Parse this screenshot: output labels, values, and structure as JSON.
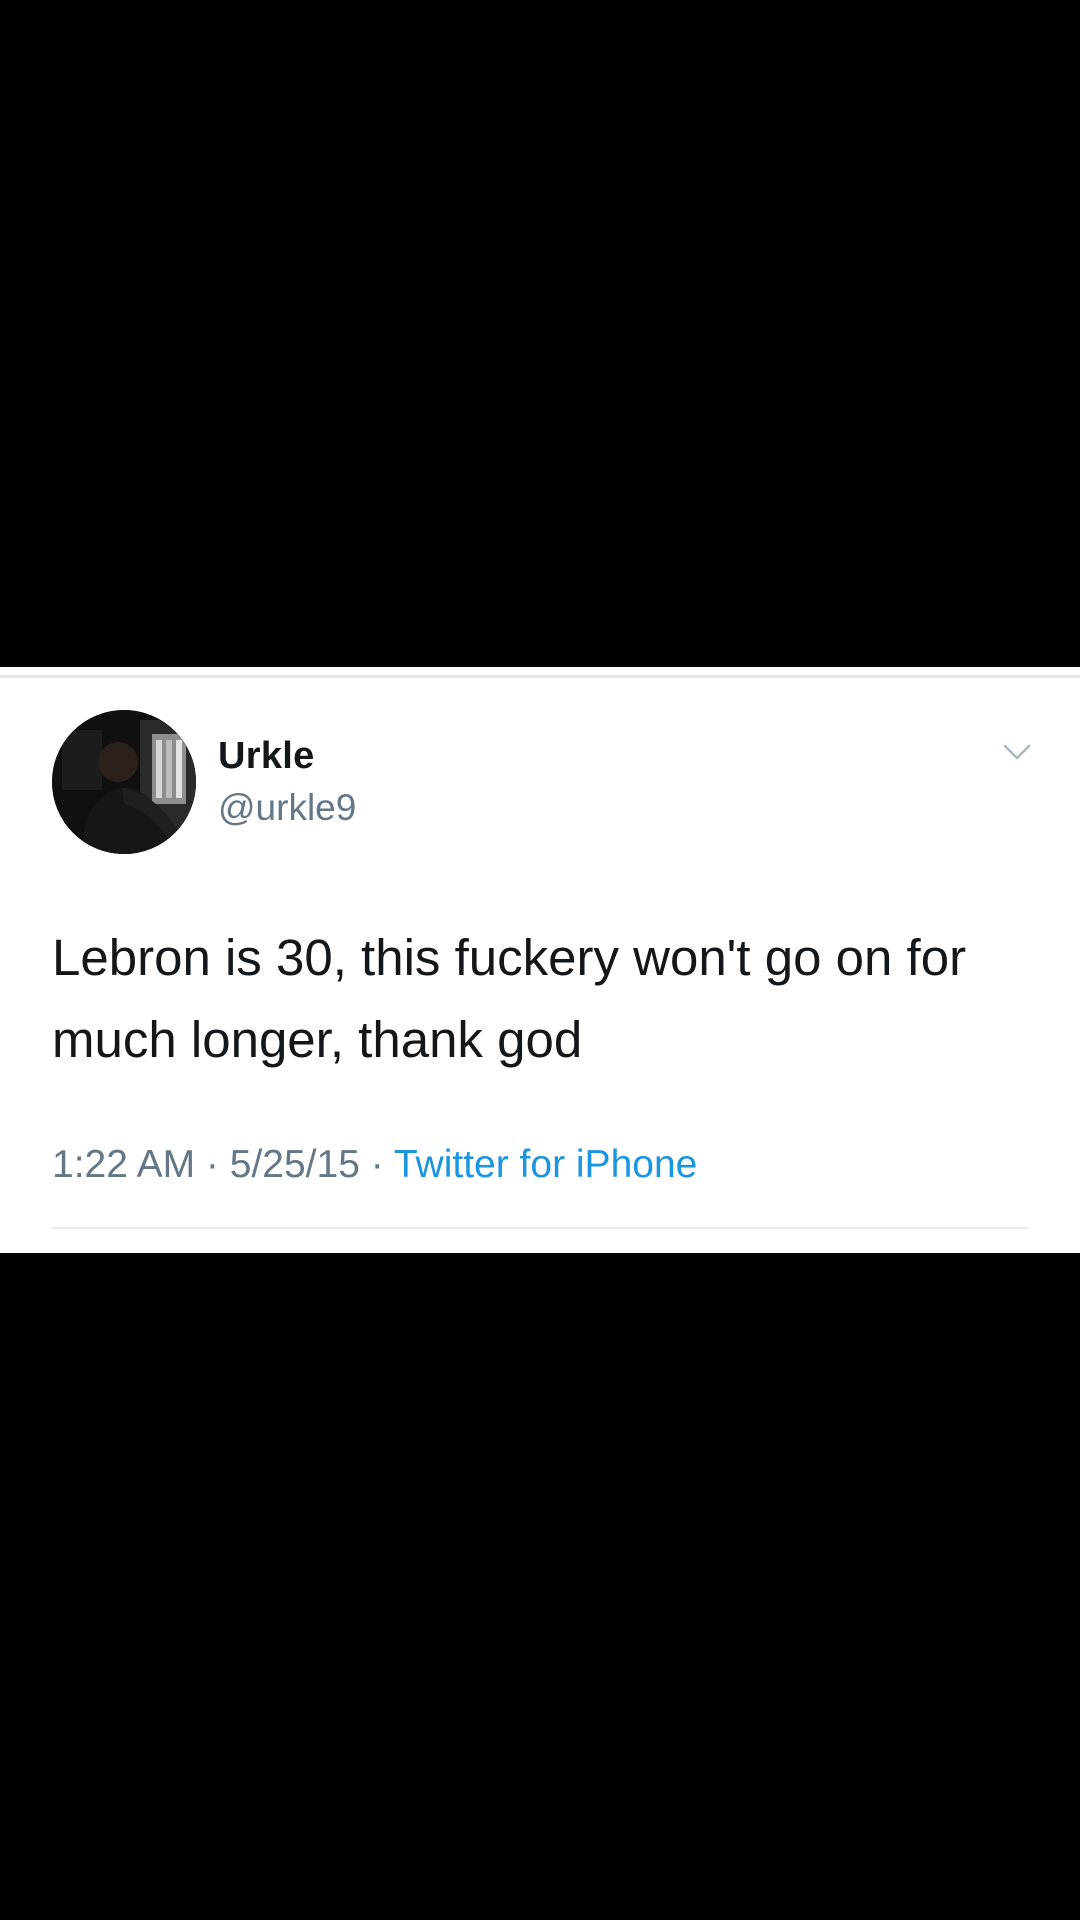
{
  "tweet": {
    "display_name": "Urkle",
    "handle": "@urkle9",
    "text": "Lebron is 30, this fuckery won't go on for much longer, thank god",
    "time": "1:22 AM",
    "date": "5/25/15",
    "separator": " · ",
    "source": "Twitter for iPhone"
  },
  "icons": {
    "avatar": "user-avatar-photo",
    "menu": "chevron-down-icon"
  },
  "colors": {
    "background": "#000000",
    "card": "#ffffff",
    "text_primary": "#14171a",
    "text_secondary": "#657786",
    "link": "#1b95e0"
  }
}
